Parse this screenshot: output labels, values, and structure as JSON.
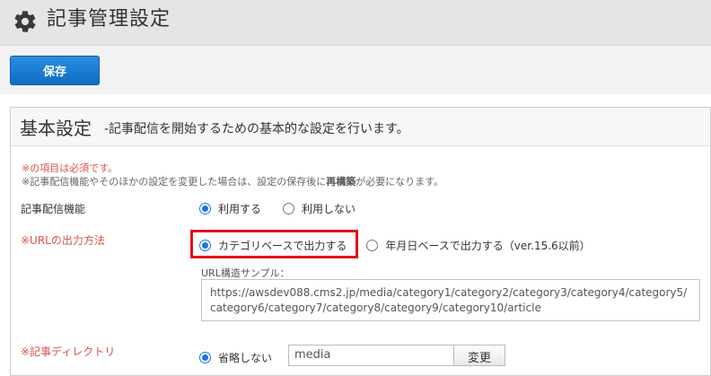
{
  "header": {
    "title": "記事管理設定",
    "icon": "gear-icon"
  },
  "toolbar": {
    "save_label": "保存"
  },
  "panel": {
    "title": "基本設定",
    "description": "-記事配信を開始するための基本的な設定を行います。",
    "note_required": "※の項目は必須です。",
    "note_rebuild_pre": "※記事配信機能やそのほかの設定を変更した場合は、設定の保存後に",
    "note_rebuild_bold": "再構築",
    "note_rebuild_post": "が必要になります。"
  },
  "distribution": {
    "label": "記事配信機能",
    "options": [
      {
        "label": "利用する",
        "selected": true
      },
      {
        "label": "利用しない",
        "selected": false
      }
    ]
  },
  "url_output": {
    "label": "※URLの出力方法",
    "options": [
      {
        "label": "カテゴリベースで出力する",
        "selected": true
      },
      {
        "label": "年月日ベースで出力する（ver.15.6以前）",
        "selected": false
      }
    ],
    "sample_label": "URL構造サンプル：",
    "sample_url": "https://awsdev088.cms2.jp/media/category1/category2/category3/category4/category5/category6/category7/category8/category9/category10/article"
  },
  "directory": {
    "label": "※記事ディレクトリ",
    "option_label": "省略しない",
    "value": "media",
    "change_label": "変更"
  },
  "colors": {
    "primary": "#1a73e8",
    "required": "#d9534f",
    "highlight": "#e3131b"
  }
}
